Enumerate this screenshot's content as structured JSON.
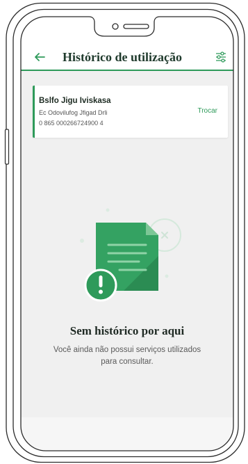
{
  "header": {
    "title": "Histórico de utilização",
    "back_icon": "arrow-left-icon",
    "filter_icon": "sliders-icon"
  },
  "account_card": {
    "name": "Bslfo Jigu Iviskasa",
    "address": "Ec Odovilufog Jfigad Drli",
    "account_number": "0 865 000266724900 4",
    "change_label": "Trocar"
  },
  "empty_state": {
    "illustration": "document-alert-illustration",
    "title": "Sem histórico por aqui",
    "description": "Você ainda não possui serviços utilizados para consultar."
  },
  "colors": {
    "accent": "#2e9a5a",
    "title_text": "#1f3a2c",
    "content_background": "#f0f0f0",
    "card_background": "#ffffff"
  }
}
